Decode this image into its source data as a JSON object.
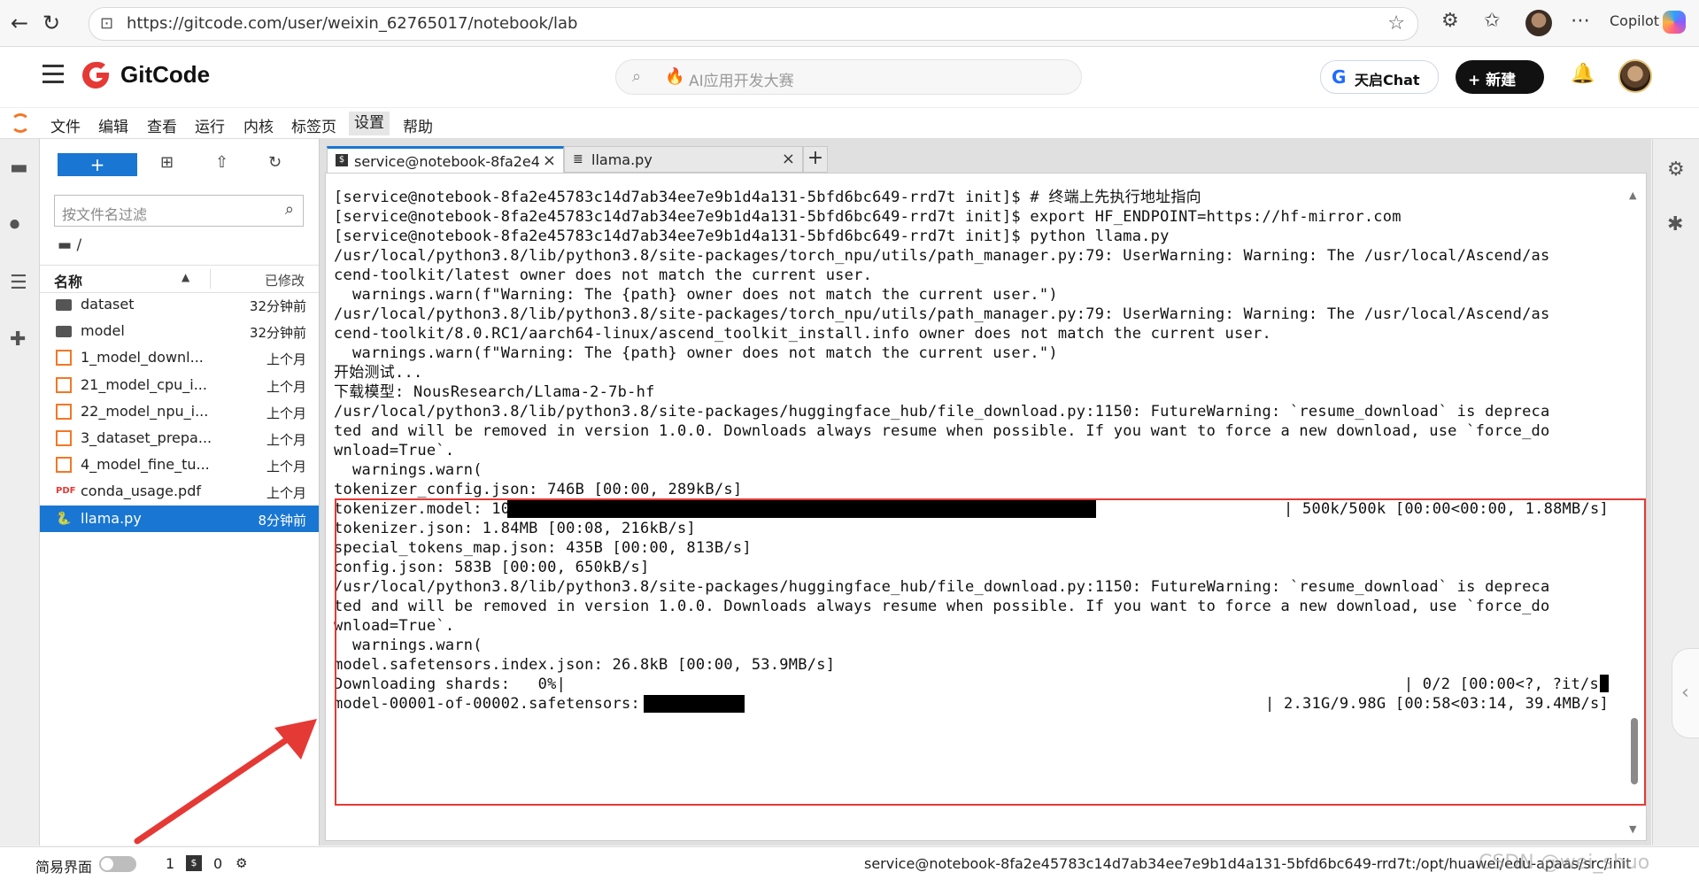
{
  "browser": {
    "url": "https://gitcode.com/user/weixin_62765017/notebook/lab",
    "copilot_label": "Copilot"
  },
  "gitcode": {
    "brand": "GitCode",
    "search_placeholder": "AI应用开发大赛",
    "chat_label": "天启Chat",
    "new_label": "+ 新建",
    "brand_color": "#e53935"
  },
  "menu": [
    "文件",
    "编辑",
    "查看",
    "运行",
    "内核",
    "标签页",
    "设置",
    "帮助"
  ],
  "file_browser": {
    "new_label": "+",
    "filter_placeholder": "按文件名过滤",
    "breadcrumb": "/",
    "col_name": "名称",
    "col_modified": "已修改",
    "files": [
      {
        "name": "dataset",
        "modified": "32分钟前",
        "type": "folder"
      },
      {
        "name": "model",
        "modified": "32分钟前",
        "type": "folder"
      },
      {
        "name": "1_model_downl...",
        "modified": "上个月",
        "type": "notebook"
      },
      {
        "name": "21_model_cpu_i...",
        "modified": "上个月",
        "type": "notebook"
      },
      {
        "name": "22_model_npu_i...",
        "modified": "上个月",
        "type": "notebook"
      },
      {
        "name": "3_dataset_prepa...",
        "modified": "上个月",
        "type": "notebook"
      },
      {
        "name": "4_model_fine_tu...",
        "modified": "上个月",
        "type": "notebook"
      },
      {
        "name": "conda_usage.pdf",
        "modified": "上个月",
        "type": "pdf"
      },
      {
        "name": "llama.py",
        "modified": "8分钟前",
        "type": "python",
        "selected": true
      }
    ]
  },
  "tabs": [
    {
      "label": "service@notebook-8fa2e4",
      "icon": "terminal-icon",
      "active": true
    },
    {
      "label": "llama.py",
      "icon": "text-file-icon",
      "active": false
    }
  ],
  "terminal": {
    "lines": [
      "[service@notebook-8fa2e45783c14d7ab34ee7e9b1d4a131-5bfd6bc649-rrd7t init]$ # 终端上先执行地址指向",
      "[service@notebook-8fa2e45783c14d7ab34ee7e9b1d4a131-5bfd6bc649-rrd7t init]$ export HF_ENDPOINT=https://hf-mirror.com",
      "[service@notebook-8fa2e45783c14d7ab34ee7e9b1d4a131-5bfd6bc649-rrd7t init]$ python llama.py",
      "/usr/local/python3.8/lib/python3.8/site-packages/torch_npu/utils/path_manager.py:79: UserWarning: Warning: The /usr/local/Ascend/as",
      "cend-toolkit/latest owner does not match the current user.",
      "  warnings.warn(f\"Warning: The {path} owner does not match the current user.\")",
      "/usr/local/python3.8/lib/python3.8/site-packages/torch_npu/utils/path_manager.py:79: UserWarning: Warning: The /usr/local/Ascend/as",
      "cend-toolkit/8.0.RC1/aarch64-linux/ascend_toolkit_install.info owner does not match the current user.",
      "  warnings.warn(f\"Warning: The {path} owner does not match the current user.\")",
      "开始测试...",
      "下载模型: NousResearch/Llama-2-7b-hf",
      "/usr/local/python3.8/lib/python3.8/site-packages/huggingface_hub/file_download.py:1150: FutureWarning: `resume_download` is depreca",
      "ted and will be removed in version 1.0.0. Downloads always resume when possible. If you want to force a new download, use `force_do",
      "wnload=True`.",
      "  warnings.warn(",
      "tokenizer_config.json: 746B [00:00, 289kB/s]"
    ],
    "progress_tokenizer": {
      "left": "tokenizer.model: 100%|",
      "right": "| 500k/500k [00:00<00:00, 1.88MB/s]",
      "fraction": 1.0
    },
    "lines2": [
      "tokenizer.json: 1.84MB [00:08, 216kB/s]",
      "special_tokens_map.json: 435B [00:00, 813B/s]",
      "config.json: 583B [00:00, 650kB/s]",
      "/usr/local/python3.8/lib/python3.8/site-packages/huggingface_hub/file_download.py:1150: FutureWarning: `resume_download` is depreca",
      "ted and will be removed in version 1.0.0. Downloads always resume when possible. If you want to force a new download, use `force_do",
      "wnload=True`.",
      "  warnings.warn(",
      "model.safetensors.index.json: 26.8kB [00:00, 53.9MB/s]"
    ],
    "progress_shards": {
      "left": "Downloading shards:   0%|",
      "right": "| 0/2 [00:00<?, ?it/s",
      "fraction": 0.0
    },
    "progress_model": {
      "left": "model-00001-of-00002.safetensors:  23%|",
      "right": "| 2.31G/9.98G [00:58<03:14, 39.4MB/s]",
      "fraction": 0.23
    }
  },
  "status": {
    "simple_mode": "简易界面",
    "count1": "1",
    "count2": "0",
    "path": "service@notebook-8fa2e45783c14d7ab34ee7e9b1d4a131-5bfd6bc649-rrd7t:/opt/huawei/edu-apaas/src/init",
    "watermark": "CSDN @wei_shuo"
  }
}
